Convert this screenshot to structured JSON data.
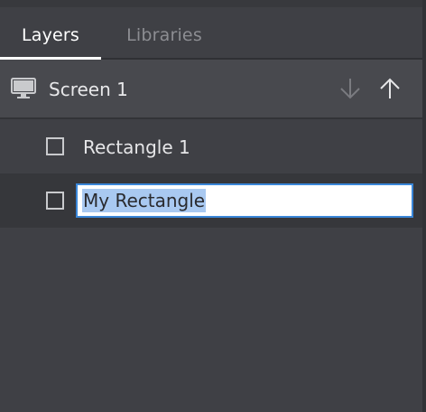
{
  "tabs": [
    {
      "label": "Layers",
      "active": true
    },
    {
      "label": "Libraries",
      "active": false
    }
  ],
  "screen": {
    "label": "Screen 1",
    "icon": "monitor-icon",
    "move_down_icon": "arrow-down-icon",
    "move_up_icon": "arrow-up-icon"
  },
  "layers": [
    {
      "label": "Rectangle 1",
      "icon": "rectangle-checkbox-icon"
    },
    {
      "label": "",
      "icon": "rectangle-checkbox-icon",
      "editing": true
    }
  ],
  "rename_input": {
    "value": "My Rectangle",
    "selected": true
  },
  "colors": {
    "panel_bg": "#3f4045",
    "screen_row_bg": "#48494e",
    "selected_row_bg": "#36373b",
    "active_tab": "#ffffff",
    "inactive_tab": "#8c8d92",
    "input_border": "#3a86d8",
    "selection_highlight": "#a9c9f1"
  }
}
